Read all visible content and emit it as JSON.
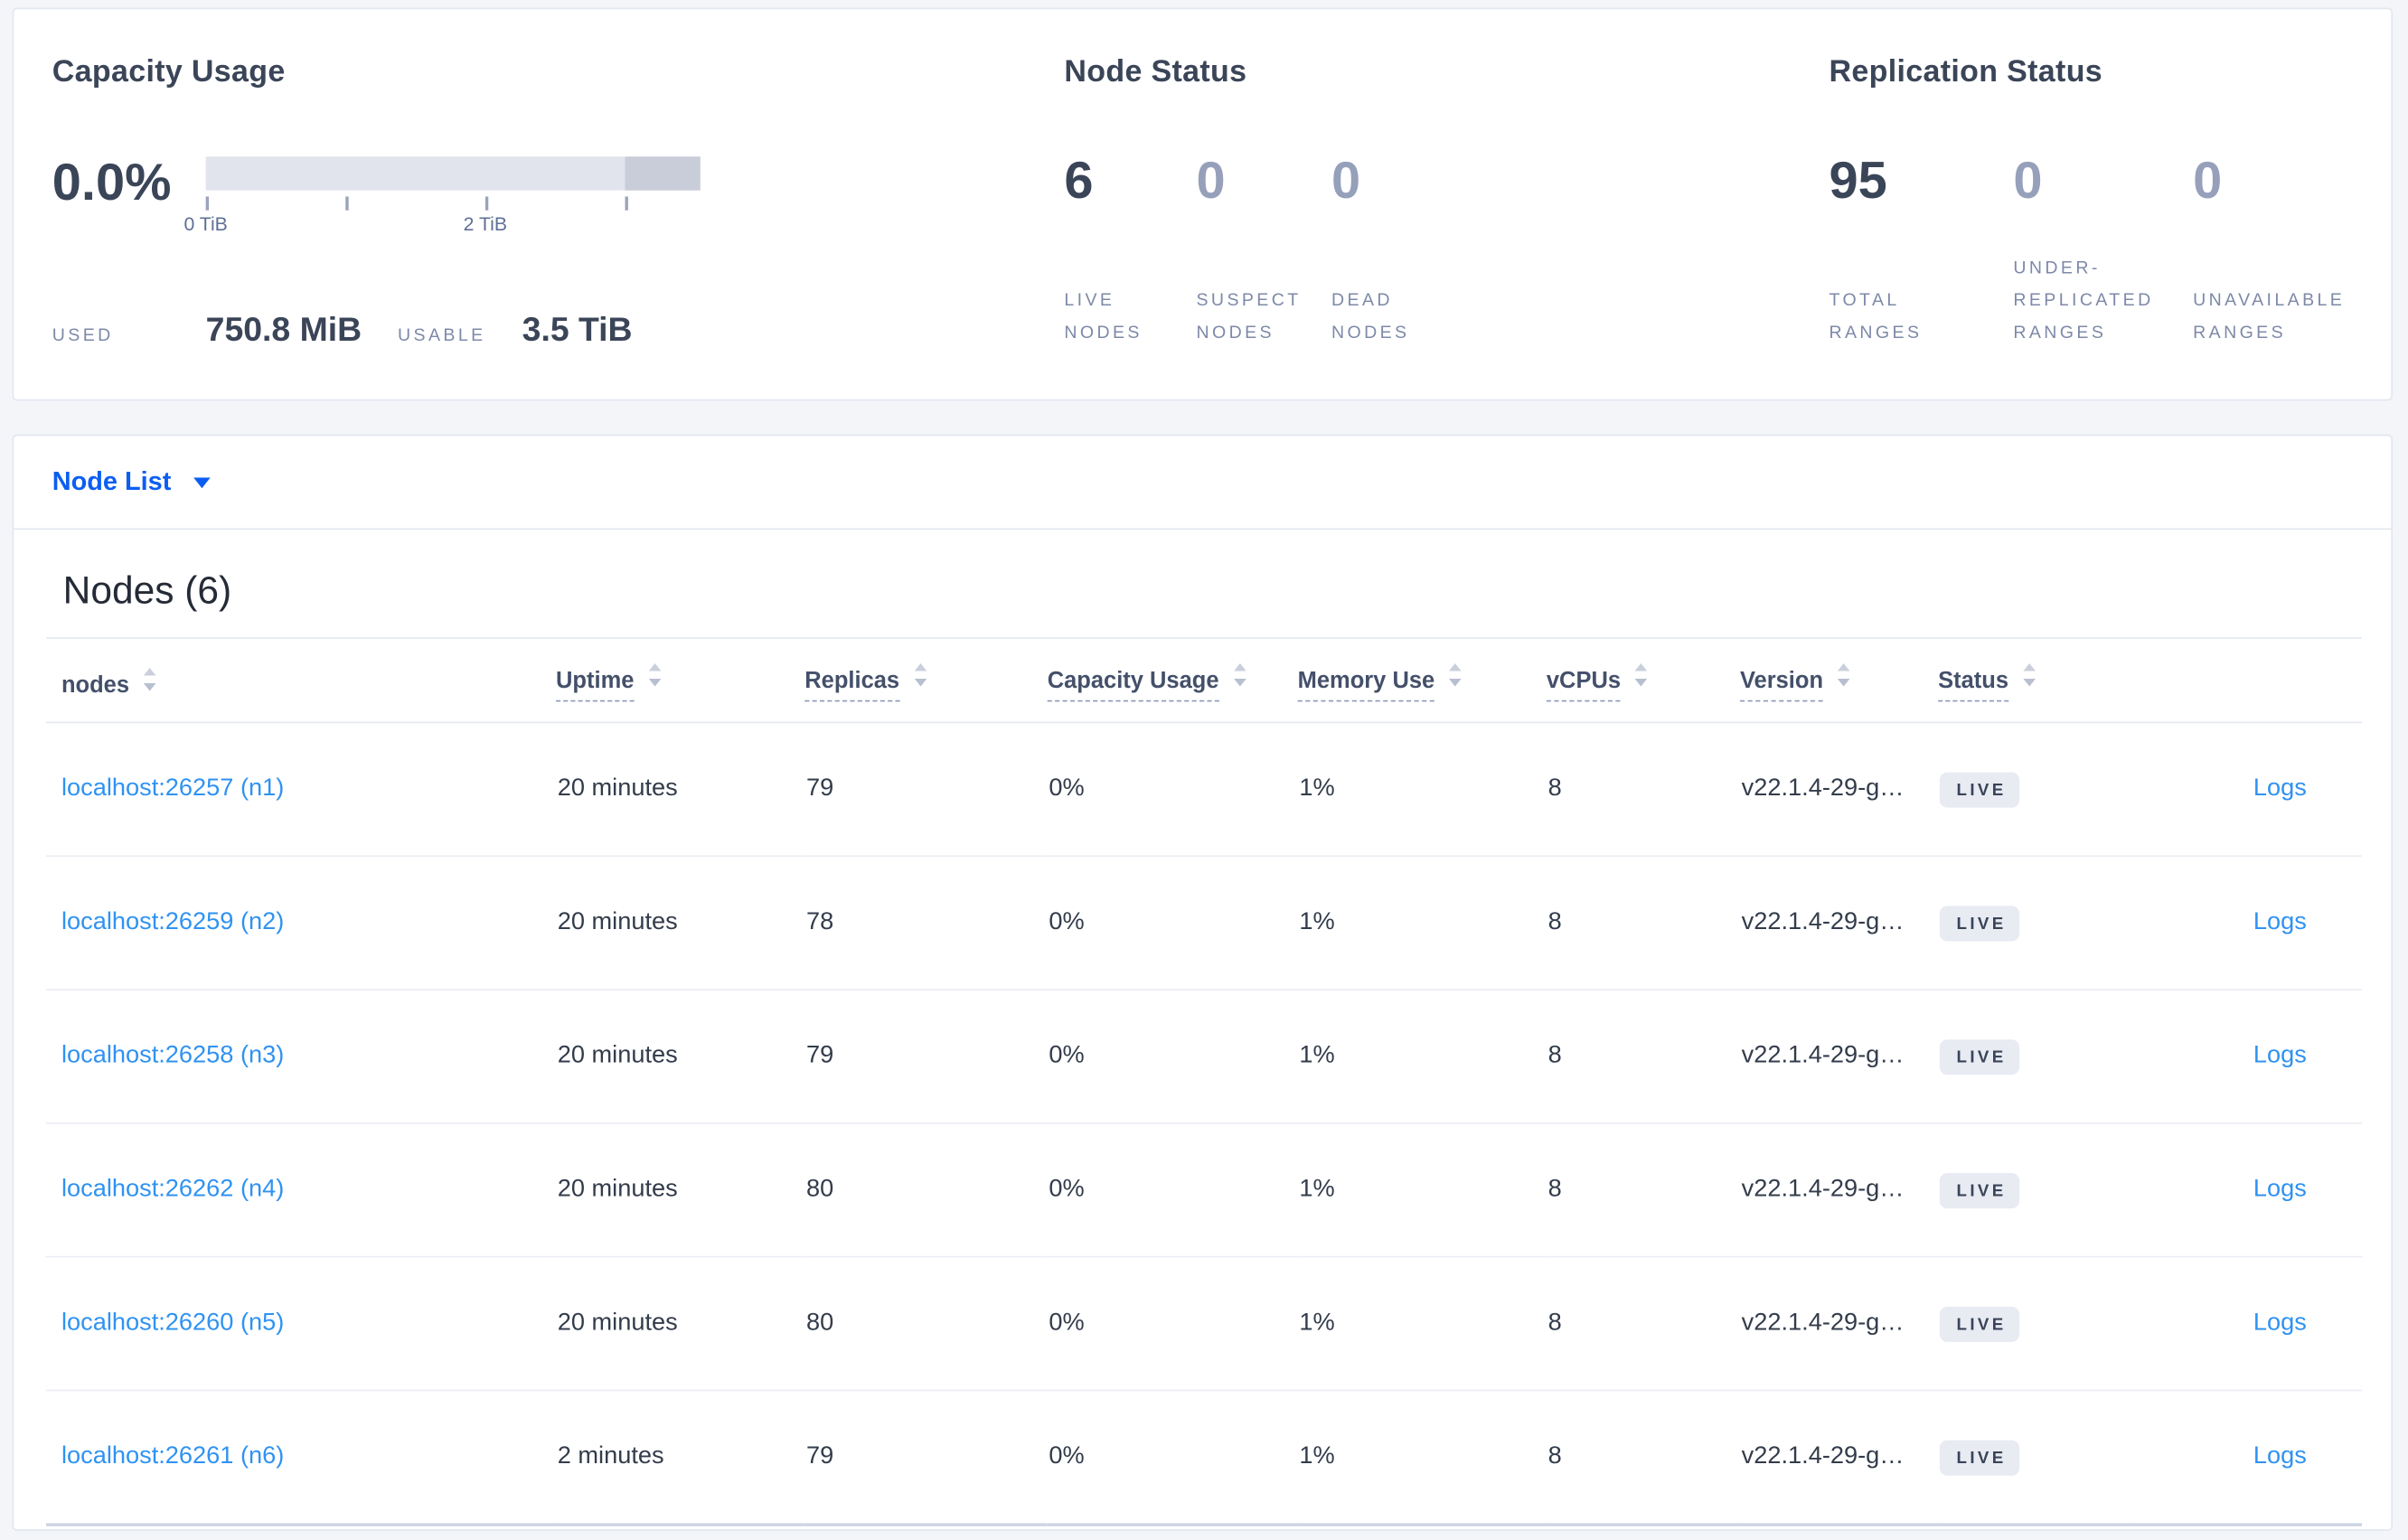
{
  "summary": {
    "capacity": {
      "title": "Capacity Usage",
      "percent": "0.0%",
      "axis_ticks": [
        "0 TiB",
        "2 TiB"
      ],
      "used_label": "USED",
      "used_value": "750.8 MiB",
      "usable_label": "USABLE",
      "usable_value": "3.5 TiB"
    },
    "node_status": {
      "title": "Node Status",
      "stats": [
        {
          "value": "6",
          "label": "LIVE NODES"
        },
        {
          "value": "0",
          "label": "SUSPECT NODES"
        },
        {
          "value": "0",
          "label": "DEAD NODES"
        }
      ]
    },
    "replication": {
      "title": "Replication Status",
      "stats": [
        {
          "value": "95",
          "label": "TOTAL RANGES"
        },
        {
          "value": "0",
          "label": "UNDER-REPLICATED RANGES"
        },
        {
          "value": "0",
          "label": "UNAVAILABLE RANGES"
        }
      ]
    }
  },
  "node_list": {
    "label": "Node List"
  },
  "nodes_section": {
    "heading": "Nodes (6)"
  },
  "table": {
    "headers": [
      {
        "label": "nodes"
      },
      {
        "label": "Uptime"
      },
      {
        "label": "Replicas"
      },
      {
        "label": "Capacity Usage"
      },
      {
        "label": "Memory Use"
      },
      {
        "label": "vCPUs"
      },
      {
        "label": "Version"
      },
      {
        "label": "Status"
      }
    ],
    "rows": [
      {
        "node": "localhost:26257 (n1)",
        "uptime": "20 minutes",
        "replicas": "79",
        "capacity_usage": "0%",
        "memory_use": "1%",
        "vcpus": "8",
        "version": "v22.1.4-29-g…",
        "status": "LIVE",
        "logs": "Logs"
      },
      {
        "node": "localhost:26259 (n2)",
        "uptime": "20 minutes",
        "replicas": "78",
        "capacity_usage": "0%",
        "memory_use": "1%",
        "vcpus": "8",
        "version": "v22.1.4-29-g…",
        "status": "LIVE",
        "logs": "Logs"
      },
      {
        "node": "localhost:26258 (n3)",
        "uptime": "20 minutes",
        "replicas": "79",
        "capacity_usage": "0%",
        "memory_use": "1%",
        "vcpus": "8",
        "version": "v22.1.4-29-g…",
        "status": "LIVE",
        "logs": "Logs"
      },
      {
        "node": "localhost:26262 (n4)",
        "uptime": "20 minutes",
        "replicas": "80",
        "capacity_usage": "0%",
        "memory_use": "1%",
        "vcpus": "8",
        "version": "v22.1.4-29-g…",
        "status": "LIVE",
        "logs": "Logs"
      },
      {
        "node": "localhost:26260 (n5)",
        "uptime": "20 minutes",
        "replicas": "80",
        "capacity_usage": "0%",
        "memory_use": "1%",
        "vcpus": "8",
        "version": "v22.1.4-29-g…",
        "status": "LIVE",
        "logs": "Logs"
      },
      {
        "node": "localhost:26261 (n6)",
        "uptime": "2 minutes",
        "replicas": "79",
        "capacity_usage": "0%",
        "memory_use": "1%",
        "vcpus": "8",
        "version": "v22.1.4-29-g…",
        "status": "LIVE",
        "logs": "Logs"
      }
    ]
  },
  "colors": {
    "page_bg": "#f3f5f9",
    "card_border": "#e2e7f0",
    "dark_text": "#3b4558",
    "muted_number": "#97a0ba",
    "muted_label": "#7d89a8",
    "dropdown_blue": "#0c5ef2",
    "link_blue": "#2f92f2",
    "bar_light": "#e2e4ed",
    "bar_dark": "#c9cdd9",
    "badge_bg": "#e8ebf2",
    "badge_text": "#39445a"
  }
}
